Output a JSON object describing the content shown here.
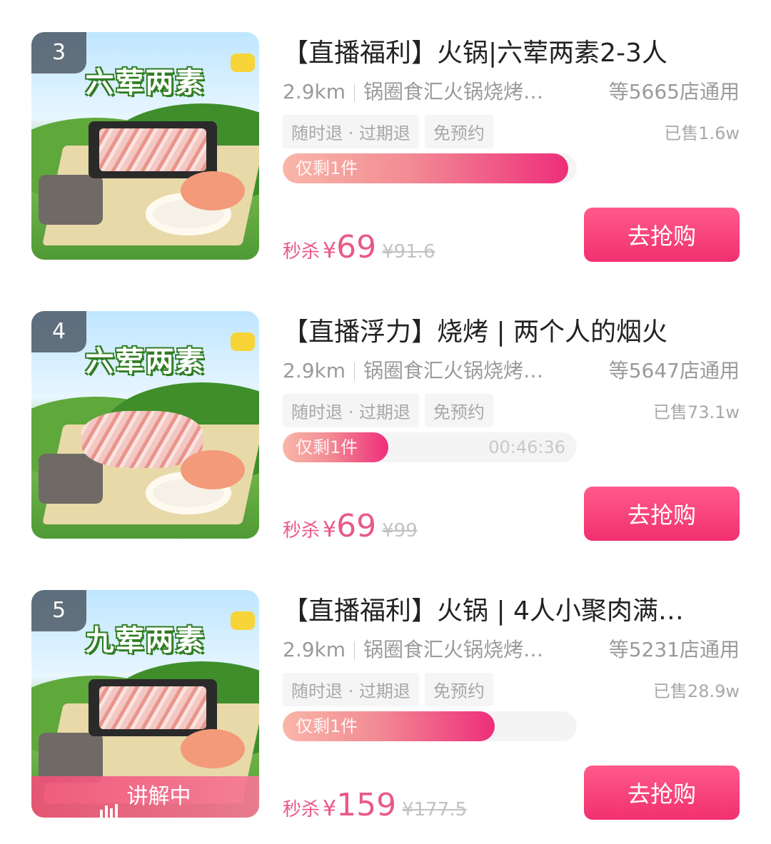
{
  "items": [
    {
      "rank": "3",
      "image_text": "六荤两素",
      "title": "【直播福利】火锅|六荤两素2-3人",
      "distance": "2.9km",
      "shop": "锅圈食汇火锅烧烤…",
      "stores": "等5665店通用",
      "tags": [
        "随时退 · 过期退",
        "免预约"
      ],
      "sold": "已售1.6w",
      "progress_label": "仅剩1件",
      "progress_fraction": 0.97,
      "timer": "",
      "price_prefix": "秒杀",
      "currency": "¥",
      "price": "69",
      "original_price": "¥91.6",
      "button": "去抢购",
      "live": ""
    },
    {
      "rank": "4",
      "image_text": "六荤两素",
      "title": "【直播浮力】烧烤 | 两个人的烟火",
      "distance": "2.9km",
      "shop": "锅圈食汇火锅烧烤…",
      "stores": "等5647店通用",
      "tags": [
        "随时退 · 过期退",
        "免预约"
      ],
      "sold": "已售73.1w",
      "progress_label": "仅剩1件",
      "progress_fraction": 0.36,
      "timer": "00:46:36",
      "price_prefix": "秒杀",
      "currency": "¥",
      "price": "69",
      "original_price": "¥99",
      "button": "去抢购",
      "live": ""
    },
    {
      "rank": "5",
      "image_text": "九荤两素",
      "title": "【直播福利】火锅 | 4人小聚肉满…",
      "distance": "2.9km",
      "shop": "锅圈食汇火锅烧烤…",
      "stores": "等5231店通用",
      "tags": [
        "随时退 · 过期退",
        "免预约"
      ],
      "sold": "已售28.9w",
      "progress_label": "仅剩1件",
      "progress_fraction": 0.72,
      "timer": "",
      "price_prefix": "秒杀",
      "currency": "¥",
      "price": "159",
      "original_price": "¥177.5",
      "button": "去抢购",
      "live": "讲解中"
    }
  ]
}
